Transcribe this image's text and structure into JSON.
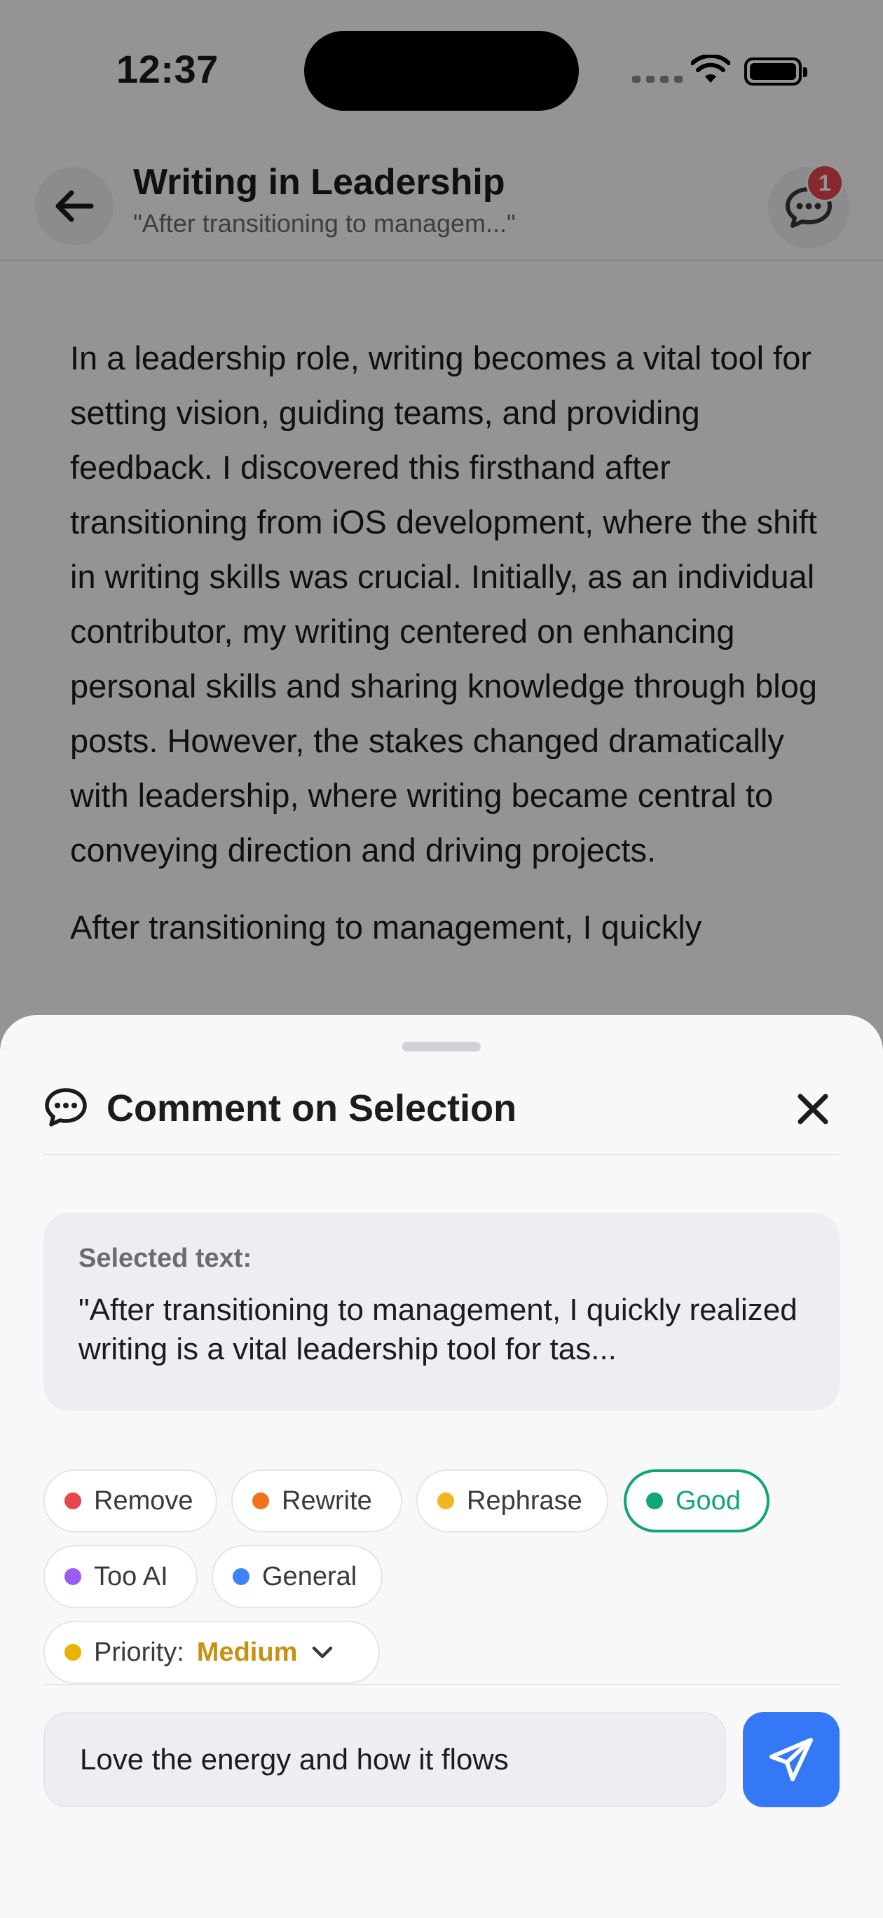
{
  "status_bar": {
    "time": "12:37"
  },
  "nav": {
    "title": "Writing in Leadership",
    "subtitle": "\"After transitioning to managem...\"",
    "comment_count": "1"
  },
  "article": {
    "paragraphs": [
      "In a leadership role, writing becomes a vital tool for setting vision, guiding teams, and providing feedback. I discovered this firsthand after transitioning from iOS development, where the shift in writing skills was crucial. Initially, as an individual contributor, my writing centered on enhancing personal skills and sharing knowledge through blog posts. However, the stakes changed dramatically with leadership, where writing became central to conveying direction and driving projects.",
      "After transitioning to management, I quickly"
    ]
  },
  "sheet": {
    "title": "Comment on Selection",
    "selected_label": "Selected text:",
    "selected_text": "\"After transitioning to management, I quickly realized writing is a vital leadership tool for tas...",
    "chips": [
      {
        "label": "Remove",
        "color": "#e5484d"
      },
      {
        "label": "Rewrite",
        "color": "#f0731c"
      },
      {
        "label": "Rephrase",
        "color": "#f2b61f"
      },
      {
        "label": "Good",
        "color": "#12a47a",
        "selected": true
      },
      {
        "label": "Too AI",
        "color": "#9b5cf0"
      },
      {
        "label": "General",
        "color": "#3d82f6"
      }
    ],
    "priority": {
      "label": "Priority:",
      "value": "Medium",
      "color": "#e6b400",
      "value_color": "#c69214"
    },
    "comment_value": "Love the energy and how it flows",
    "accent_send": "#3478f6"
  }
}
